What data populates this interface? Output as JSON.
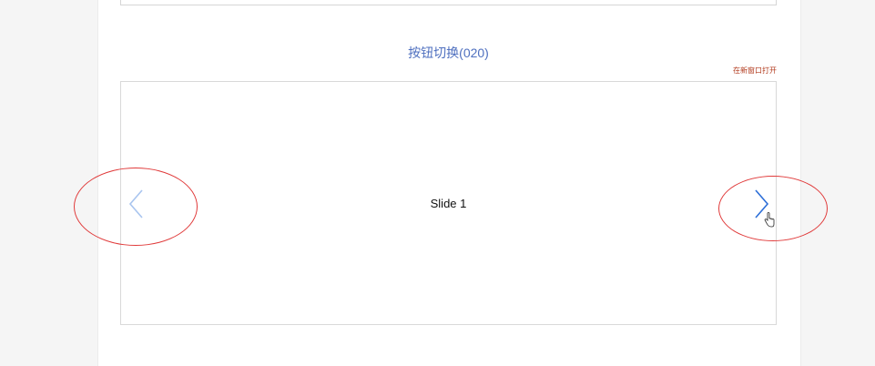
{
  "section": {
    "title": "按钮切换(020)",
    "open_in_new_window": "在新窗口打开"
  },
  "swiper": {
    "slides": [
      "Slide 1"
    ],
    "active_index": 0,
    "prev_button": {
      "icon": "chevron-left-icon",
      "disabled": true,
      "color": "#a9c5ef"
    },
    "next_button": {
      "icon": "chevron-right-icon",
      "disabled": false,
      "color": "#2d6fd8"
    }
  },
  "colors": {
    "title": "#4e6fbf",
    "link": "#b23a1d",
    "annotation": "#e03a3a"
  }
}
